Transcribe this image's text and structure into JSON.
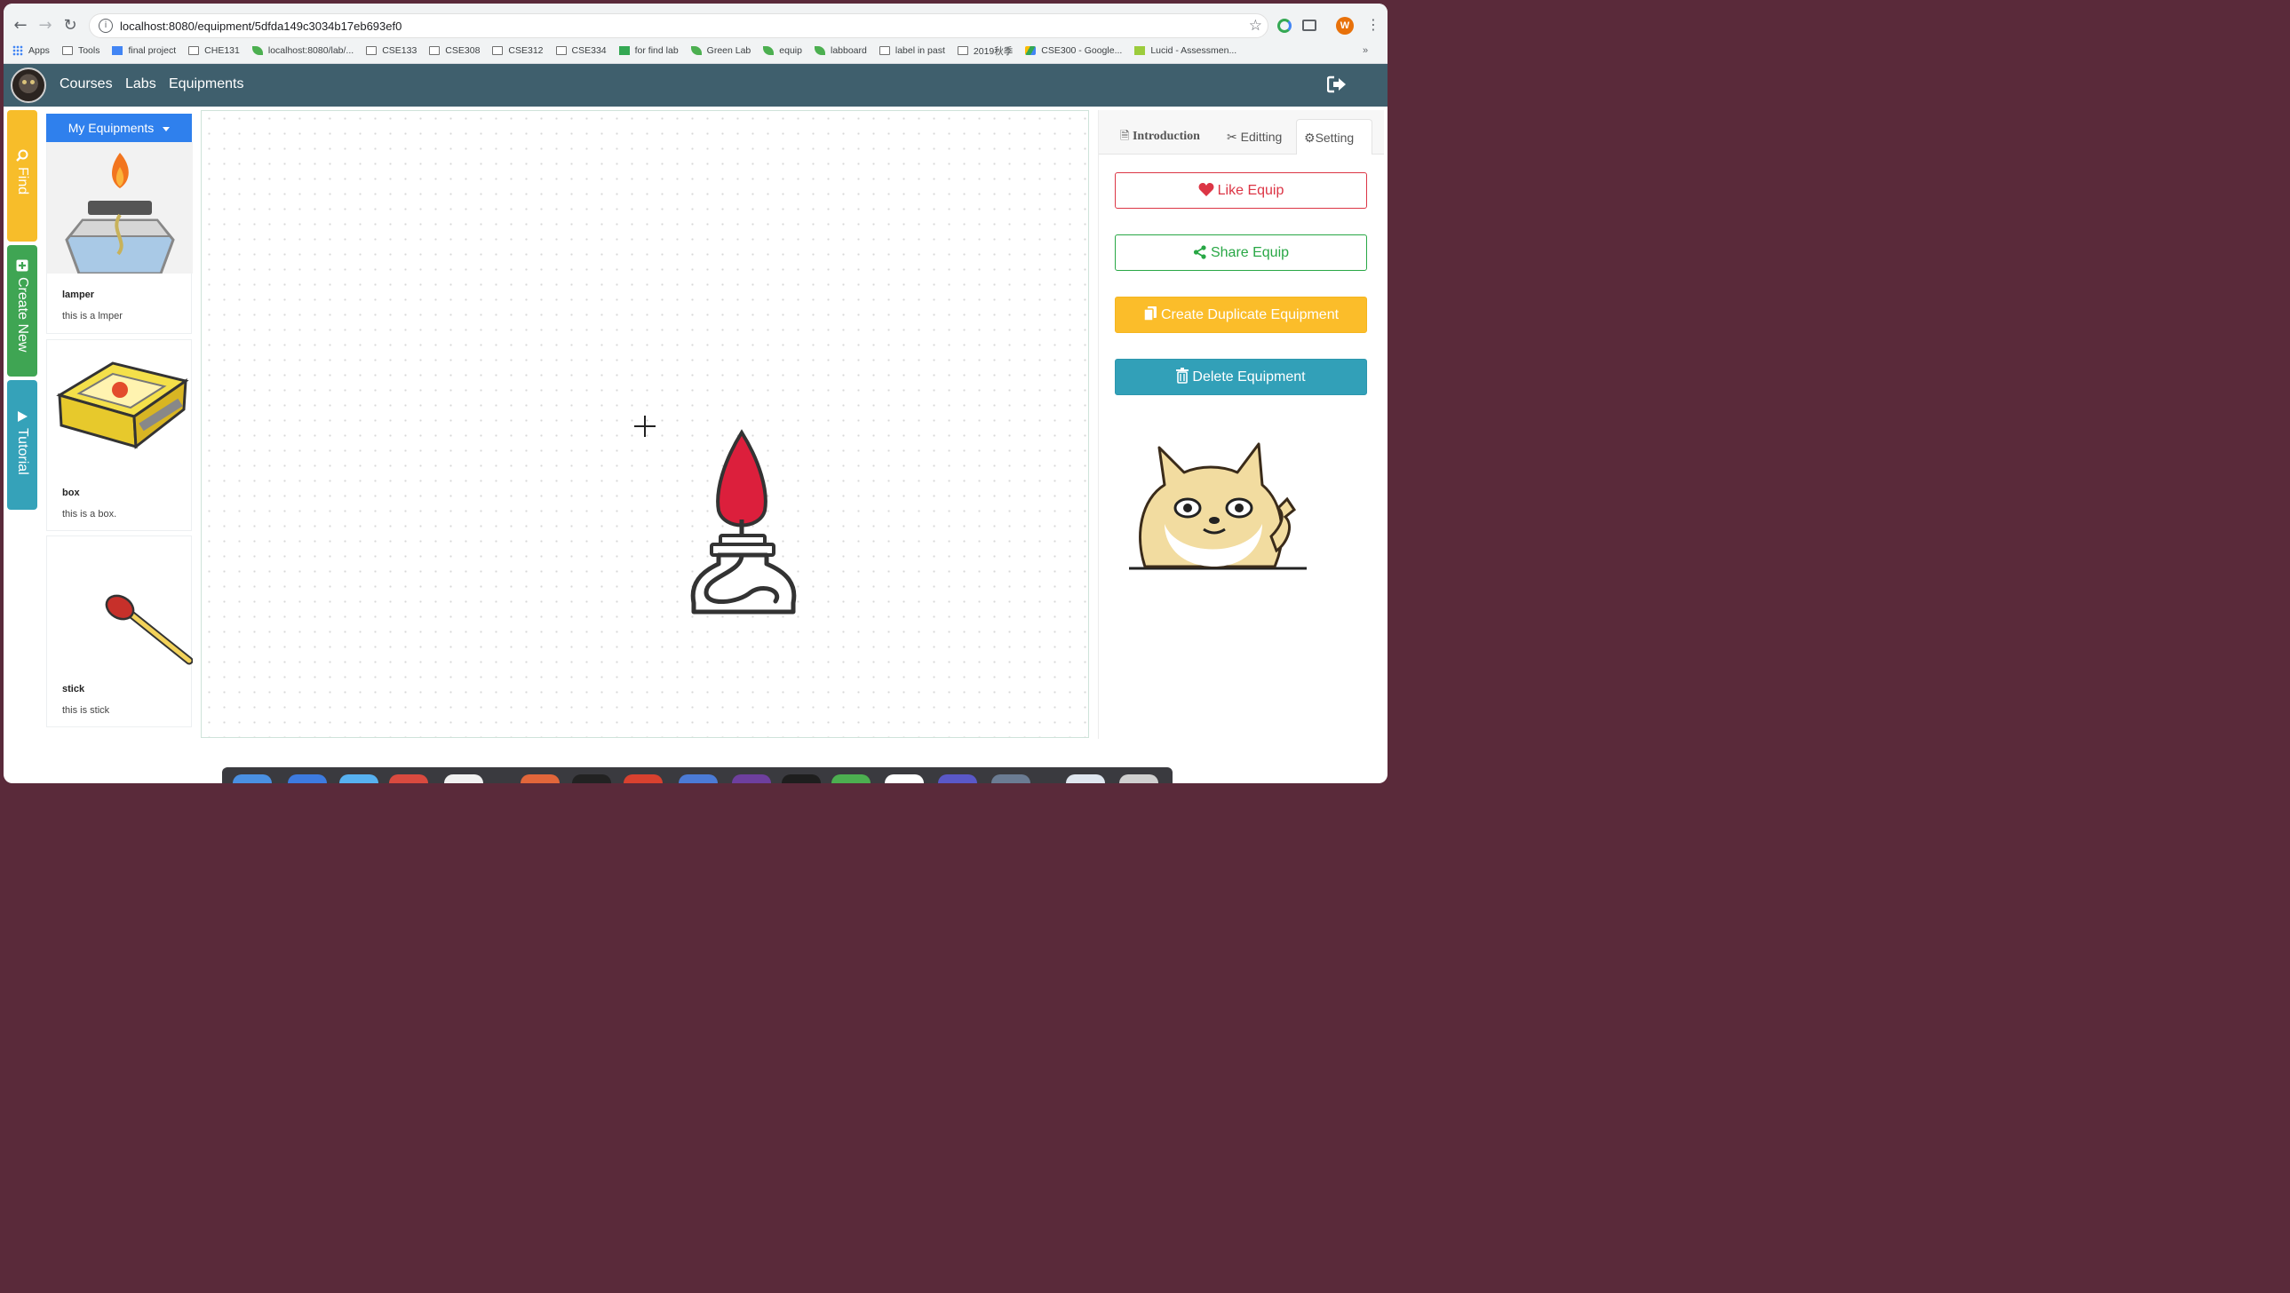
{
  "browser": {
    "url": "localhost:8080/equipment/5dfda149c3034b17eb693ef0",
    "profile_initial": "W",
    "bookmarks": [
      {
        "label": "Apps",
        "icon": "apps-grid-icon"
      },
      {
        "label": "Tools",
        "icon": "folder-icon"
      },
      {
        "label": "final project",
        "icon": "doc-icon"
      },
      {
        "label": "CHE131",
        "icon": "folder-icon"
      },
      {
        "label": "localhost:8080/lab/...",
        "icon": "leaf-icon"
      },
      {
        "label": "CSE133",
        "icon": "folder-icon"
      },
      {
        "label": "CSE308",
        "icon": "folder-icon"
      },
      {
        "label": "CSE312",
        "icon": "folder-icon"
      },
      {
        "label": "CSE334",
        "icon": "folder-icon"
      },
      {
        "label": "for find lab",
        "icon": "green-icon"
      },
      {
        "label": "Green Lab",
        "icon": "leaf-icon"
      },
      {
        "label": "equip",
        "icon": "leaf-icon"
      },
      {
        "label": "labboard",
        "icon": "leaf-icon"
      },
      {
        "label": "label in past",
        "icon": "folder-icon"
      },
      {
        "label": "2019秋季",
        "icon": "folder-icon"
      },
      {
        "label": "CSE300 - Google...",
        "icon": "drive-icon"
      },
      {
        "label": "Lucid - Assessmen...",
        "icon": "lucid-icon"
      }
    ],
    "more": "»"
  },
  "navbar": {
    "links": [
      "Courses",
      "Labs",
      "Equipments"
    ]
  },
  "side_tabs": {
    "find": "Find",
    "create_new": "Create New",
    "tutorial": "Tutorial"
  },
  "equipment_list": {
    "dropdown_label": "My Equipments",
    "items": [
      {
        "name": "lamper",
        "description": "this is a lmper",
        "image": "alcohol-lamp-image"
      },
      {
        "name": "box",
        "description": "this is a box.",
        "image": "matchbox-image"
      },
      {
        "name": "stick",
        "description": "this is stick",
        "image": "matchstick-image"
      }
    ]
  },
  "canvas": {
    "object": "alcohol-lamp-icon"
  },
  "panel": {
    "tabs": [
      "Introduction",
      "Editting",
      "Setting"
    ],
    "active_tab": "Setting",
    "buttons": {
      "like": "Like Equip",
      "share": "Share Equip",
      "duplicate": "Create Duplicate Equipment",
      "delete": "Delete Equipment"
    },
    "sticker": "doge-sticker-image"
  },
  "colors": {
    "navbar": "#3f5f6d",
    "primary": "#2f80ed",
    "find_tab": "#f7bd2a",
    "create_tab": "#3fa553",
    "tutorial_tab": "#35a2b9",
    "danger": "#dc3545",
    "success": "#28a745",
    "warning": "#fbbd2a",
    "info": "#32a0b8"
  }
}
